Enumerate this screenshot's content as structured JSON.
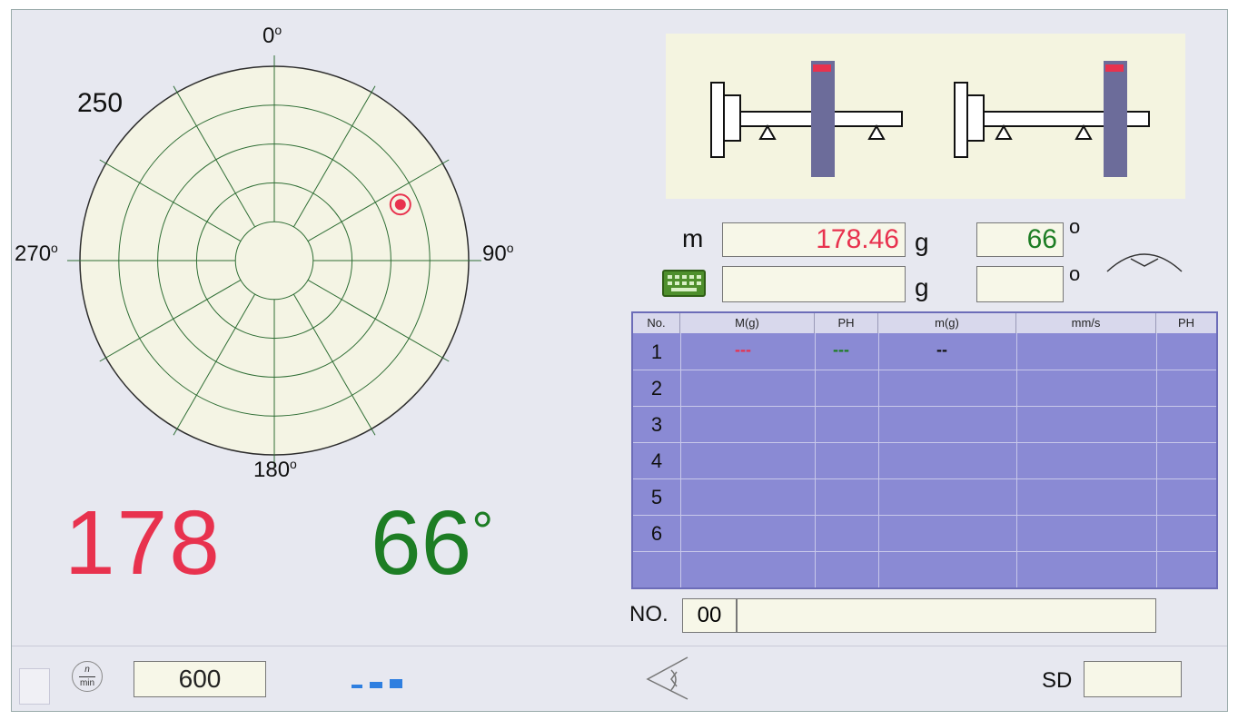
{
  "polar": {
    "label_top": "0",
    "label_right": "90",
    "label_bottom": "180",
    "label_left": "270",
    "scale": "250",
    "degree_mark": "o",
    "marker_angle_deg": 66,
    "marker_radius_fraction": 0.71,
    "rings": 5,
    "spokes": 12
  },
  "readout": {
    "mass": "178",
    "angle": "66",
    "degree_symbol": "°"
  },
  "inputs": {
    "m_label": "m",
    "m_value": "178.46",
    "m_unit": "g",
    "angle_value": "66",
    "angle_unit": "o",
    "m2_value": "",
    "m2_unit": "g",
    "angle2_value": "",
    "angle2_unit": "o"
  },
  "table": {
    "headers": [
      "No.",
      "M(g)",
      "PH",
      "m(g)",
      "mm/s",
      "PH"
    ],
    "rows": [
      "1",
      "2",
      "3",
      "4",
      "5",
      "6"
    ],
    "row1": {
      "M": "---",
      "PH": "---",
      "m": "--"
    }
  },
  "record": {
    "label": "NO.",
    "number": "00",
    "name": ""
  },
  "bottom": {
    "speed_unit_top": "n",
    "speed_unit_bottom": "min",
    "speed_value": "600",
    "sd_label": "SD",
    "sd_value": ""
  },
  "colors": {
    "mass": "#e8324e",
    "angle": "#1d7d24",
    "table_bg": "#8a8ad4",
    "field_bg": "#f7f7e8"
  },
  "icons": {
    "keyboard": "keyboard-icon",
    "eye": "eye-icon",
    "arc": "arc-angle-icon",
    "rpm": "rpm-icon",
    "signal": "signal-bars-icon",
    "marker": "unbalance-marker-icon"
  }
}
